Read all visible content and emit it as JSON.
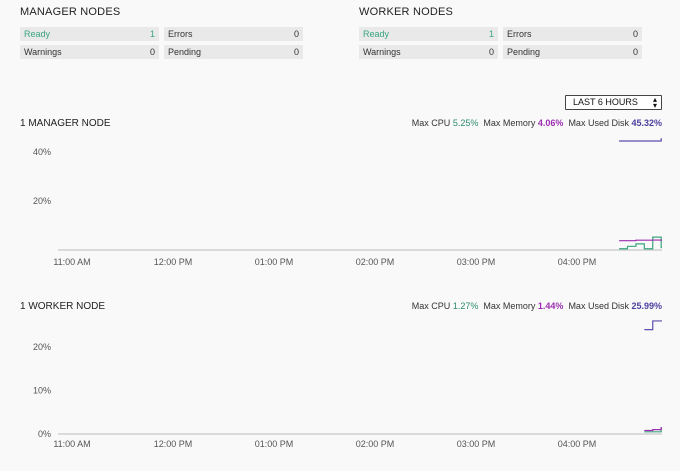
{
  "manager_nodes": {
    "title": "MANAGER NODES",
    "ready": {
      "label": "Ready",
      "value": "1"
    },
    "errors": {
      "label": "Errors",
      "value": "0"
    },
    "warnings": {
      "label": "Warnings",
      "value": "0"
    },
    "pending": {
      "label": "Pending",
      "value": "0"
    }
  },
  "worker_nodes": {
    "title": "WORKER NODES",
    "ready": {
      "label": "Ready",
      "value": "1"
    },
    "errors": {
      "label": "Errors",
      "value": "0"
    },
    "warnings": {
      "label": "Warnings",
      "value": "0"
    },
    "pending": {
      "label": "Pending",
      "value": "0"
    }
  },
  "time_range": {
    "selected": "LAST 6 HOURS"
  },
  "manager_chart": {
    "title": "1 MANAGER NODE",
    "max_cpu_label": "Max CPU",
    "max_cpu": "5.25%",
    "max_memory_label": "Max Memory",
    "max_memory": "4.06%",
    "max_disk_label": "Max Used Disk",
    "max_disk": "45.32%"
  },
  "worker_chart": {
    "title": "1 WORKER NODE",
    "max_cpu_label": "Max CPU",
    "max_cpu": "1.27%",
    "max_memory_label": "Max Memory",
    "max_memory": "1.44%",
    "max_disk_label": "Max Used Disk",
    "max_disk": "25.99%"
  },
  "colors": {
    "cpu": "#3aa57e",
    "memory": "#9b2fb0",
    "disk": "#5b4fb0",
    "ready": "#3aa57e"
  },
  "chart_data": [
    {
      "type": "line",
      "x_tick_labels": [
        "11:00 AM",
        "12:00 PM",
        "01:00 PM",
        "02:00 PM",
        "03:00 PM",
        "04:00 PM"
      ],
      "y_tick_labels": [
        "20%",
        "40%"
      ],
      "ylim": [
        0,
        50
      ],
      "grid": false,
      "series": [
        {
          "name": "Max CPU",
          "x": [
            "04:25 PM",
            "04:30 PM",
            "04:35 PM",
            "04:40 PM",
            "04:45 PM",
            "04:50 PM"
          ],
          "y": [
            0.5,
            1.5,
            2.5,
            0.5,
            5.25,
            1.0
          ]
        },
        {
          "name": "Max Memory",
          "x": [
            "04:25 PM",
            "04:35 PM",
            "04:45 PM",
            "04:50 PM"
          ],
          "y": [
            3.8,
            4.0,
            4.06,
            4.0
          ]
        },
        {
          "name": "Max Used Disk",
          "x": [
            "04:25 PM",
            "04:45 PM",
            "04:50 PM"
          ],
          "y": [
            44.5,
            44.5,
            45.32
          ]
        }
      ]
    },
    {
      "type": "line",
      "x_tick_labels": [
        "11:00 AM",
        "12:00 PM",
        "01:00 PM",
        "02:00 PM",
        "03:00 PM",
        "04:00 PM"
      ],
      "y_tick_labels": [
        "0%",
        "10%",
        "20%"
      ],
      "ylim": [
        0,
        30
      ],
      "grid": false,
      "series": [
        {
          "name": "Max CPU",
          "x": [
            "04:40 PM",
            "04:50 PM"
          ],
          "y": [
            0.5,
            1.27
          ]
        },
        {
          "name": "Max Memory",
          "x": [
            "04:40 PM",
            "04:45 PM",
            "04:50 PM"
          ],
          "y": [
            0.8,
            1.0,
            1.44
          ]
        },
        {
          "name": "Max Used Disk",
          "x": [
            "04:40 PM",
            "04:45 PM",
            "04:50 PM"
          ],
          "y": [
            24.0,
            25.99,
            25.99
          ]
        }
      ]
    }
  ]
}
